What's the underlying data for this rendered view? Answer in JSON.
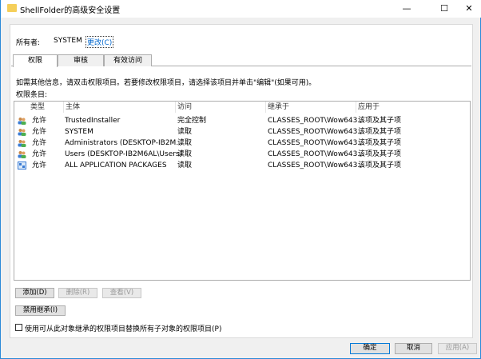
{
  "window": {
    "title": "ShellFolder的高级安全设置",
    "minimize": "—",
    "maximize": "☐",
    "close": "✕"
  },
  "owner": {
    "label": "所有者:",
    "value": "SYSTEM",
    "change_link": "更改(C)"
  },
  "tabs": [
    {
      "label": "权限"
    },
    {
      "label": "审核"
    },
    {
      "label": "有效访问"
    }
  ],
  "info_text": "如需其他信息，请双击权限项目。若要修改权限项目，请选择该项目并单击\"编辑\"(如果可用)。",
  "list_label": "权限条目:",
  "columns": [
    "类型",
    "主体",
    "访问",
    "继承于",
    "应用于"
  ],
  "entries": [
    {
      "icon": "users-icon",
      "type": "允许",
      "principal": "TrustedInstaller",
      "access": "完全控制",
      "inherited": "CLASSES_ROOT\\Wow643...",
      "applies": "该项及其子项"
    },
    {
      "icon": "users-icon",
      "type": "允许",
      "principal": "SYSTEM",
      "access": "读取",
      "inherited": "CLASSES_ROOT\\Wow643...",
      "applies": "该项及其子项"
    },
    {
      "icon": "users-icon",
      "type": "允许",
      "principal": "Administrators (DESKTOP-IB2M...",
      "access": "读取",
      "inherited": "CLASSES_ROOT\\Wow643...",
      "applies": "该项及其子项"
    },
    {
      "icon": "users-icon",
      "type": "允许",
      "principal": "Users (DESKTOP-IB2M6AL\\Users)",
      "access": "读取",
      "inherited": "CLASSES_ROOT\\Wow643...",
      "applies": "该项及其子项"
    },
    {
      "icon": "app-packages-icon",
      "type": "允许",
      "principal": "ALL APPLICATION PACKAGES",
      "access": "读取",
      "inherited": "CLASSES_ROOT\\Wow643...",
      "applies": "该项及其子项"
    }
  ],
  "buttons": {
    "add": "添加(D)",
    "remove": "删除(R)",
    "view": "查看(V)",
    "disable_inheritance": "禁用继承(I)",
    "ok": "确定",
    "cancel": "取消",
    "apply": "应用(A)"
  },
  "replace_checkbox": {
    "label": "使用可从此对象继承的权限项目替换所有子对象的权限项目(P)",
    "checked": false
  }
}
